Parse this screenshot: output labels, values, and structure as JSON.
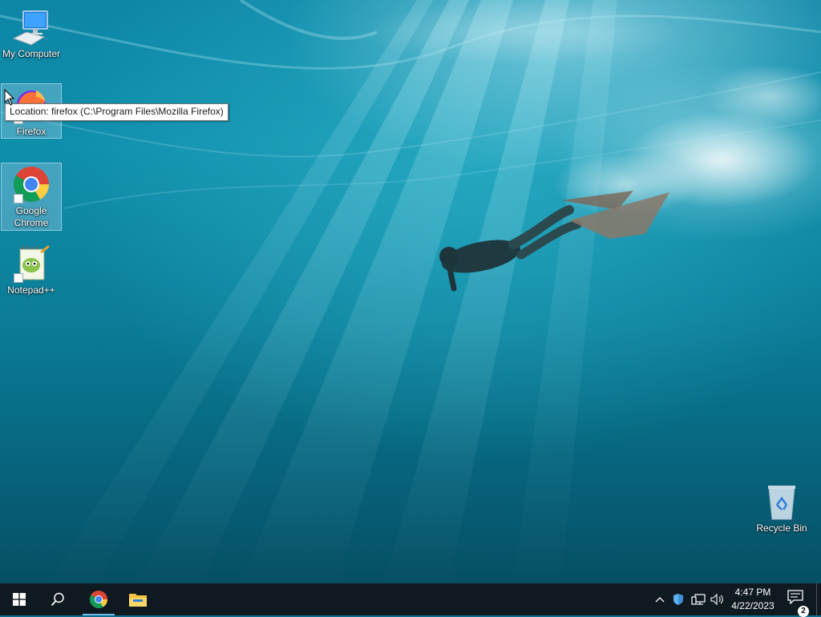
{
  "desktop": {
    "icons": [
      {
        "label": "My Computer",
        "icon": "computer-icon",
        "selected": false
      },
      {
        "label": "Firefox",
        "icon": "firefox-icon",
        "selected": true
      },
      {
        "label": "Google Chrome",
        "icon": "chrome-icon",
        "selected": true
      },
      {
        "label": "Notepad++",
        "icon": "notepadpp-icon",
        "selected": false
      },
      {
        "label": "Recycle Bin",
        "icon": "recycle-bin-icon",
        "selected": false
      }
    ],
    "tooltip": "Location: firefox (C:\\Program Files\\Mozilla Firefox)"
  },
  "taskbar": {
    "buttons": [
      {
        "icon": "windows-start-icon"
      },
      {
        "icon": "search-icon"
      },
      {
        "icon": "chrome-icon",
        "active": true
      },
      {
        "icon": "file-explorer-icon"
      }
    ],
    "tray": {
      "icons": [
        "chevron-up-icon",
        "defender-icon",
        "network-icon",
        "volume-icon"
      ],
      "time": "4:47 PM",
      "date": "4/22/2023",
      "notification_count": "2"
    }
  },
  "colors": {
    "taskbar_bg": "#0f1a20",
    "accent": "#76b9ed",
    "selection": "#aad2eb"
  }
}
